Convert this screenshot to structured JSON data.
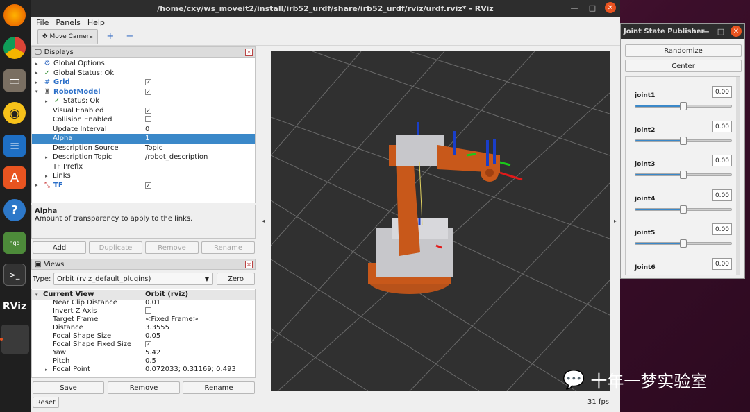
{
  "window": {
    "title": "/home/cxy/ws_moveit2/install/irb52_urdf/share/irb52_urdf/rviz/urdf.rviz* - RViz"
  },
  "menu": [
    "File",
    "Panels",
    "Help"
  ],
  "toolbar": {
    "move_camera": "Move Camera",
    "plus": "+",
    "minus": "−"
  },
  "displays": {
    "title": "Displays",
    "rows": [
      {
        "name": "Global Options",
        "value": ""
      },
      {
        "name": "Global Status: Ok",
        "value": ""
      },
      {
        "name": "Grid",
        "value": "✓"
      },
      {
        "name": "RobotModel",
        "value": "✓"
      },
      {
        "name": "Status: Ok",
        "value": ""
      },
      {
        "name": "Visual Enabled",
        "value": "✓"
      },
      {
        "name": "Collision Enabled",
        "value": ""
      },
      {
        "name": "Update Interval",
        "value": "0"
      },
      {
        "name": "Alpha",
        "value": "1"
      },
      {
        "name": "Description Source",
        "value": "Topic"
      },
      {
        "name": "Description Topic",
        "value": "/robot_description"
      },
      {
        "name": "TF Prefix",
        "value": ""
      },
      {
        "name": "Links",
        "value": ""
      },
      {
        "name": "TF",
        "value": "✓"
      }
    ],
    "desc_title": "Alpha",
    "desc_text": "Amount of transparency to apply to the links.",
    "buttons": {
      "add": "Add",
      "duplicate": "Duplicate",
      "remove": "Remove",
      "rename": "Rename"
    }
  },
  "views": {
    "title": "Views",
    "type_label": "Type:",
    "type_value": "Orbit (rviz_default_plugins)",
    "zero": "Zero",
    "header_name": "Current View",
    "header_value": "Orbit (rviz)",
    "rows": [
      {
        "name": "Near Clip Distance",
        "value": "0.01"
      },
      {
        "name": "Invert Z Axis",
        "value": ""
      },
      {
        "name": "Target Frame",
        "value": "<Fixed Frame>"
      },
      {
        "name": "Distance",
        "value": "3.3555"
      },
      {
        "name": "Focal Shape Size",
        "value": "0.05"
      },
      {
        "name": "Focal Shape Fixed Size",
        "value": "✓"
      },
      {
        "name": "Yaw",
        "value": "5.42"
      },
      {
        "name": "Pitch",
        "value": "0.5"
      },
      {
        "name": "Focal Point",
        "value": "0.072033; 0.31169; 0.493"
      }
    ],
    "buttons": {
      "save": "Save",
      "remove": "Remove",
      "rename": "Rename"
    }
  },
  "reset": "Reset",
  "fps": "31 fps",
  "jsp": {
    "title": "Joint State Publisher",
    "randomize": "Randomize",
    "center": "Center",
    "joints": [
      {
        "name": "joint1",
        "value": "0.00",
        "level": 0.5
      },
      {
        "name": "joint2",
        "value": "0.00",
        "level": 0.5
      },
      {
        "name": "joint3",
        "value": "0.00",
        "level": 0.5
      },
      {
        "name": "joint4",
        "value": "0.00",
        "level": 0.5
      },
      {
        "name": "joint5",
        "value": "0.00",
        "level": 0.5
      },
      {
        "name": "Joint6",
        "value": "0.00",
        "level": 0.5
      }
    ]
  },
  "watermark": "十年一梦实验室",
  "colors": {
    "accent": "#3a88c9",
    "robot_orange": "#c8581a",
    "ubuntu_orange": "#e95420"
  }
}
